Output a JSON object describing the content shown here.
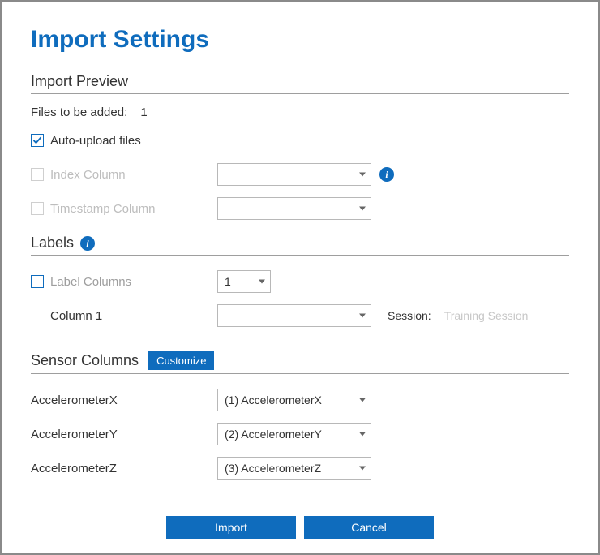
{
  "title": "Import Settings",
  "preview": {
    "heading": "Import Preview",
    "files_label": "Files to be added:",
    "files_count": "1",
    "auto_upload": {
      "label": "Auto-upload files",
      "checked": true
    },
    "index_col": {
      "label": "Index Column",
      "checked": false,
      "value": ""
    },
    "timestamp_col": {
      "label": "Timestamp Column",
      "checked": false,
      "value": ""
    }
  },
  "labels": {
    "heading": "Labels",
    "label_columns": {
      "label": "Label Columns",
      "checked": false,
      "count": "1"
    },
    "column1": {
      "label": "Column 1",
      "value": ""
    },
    "session_label": "Session:",
    "session_value": "Training Session"
  },
  "sensor": {
    "heading": "Sensor Columns",
    "customize_label": "Customize",
    "rows": [
      {
        "name": "AccelerometerX",
        "value": "(1) AccelerometerX"
      },
      {
        "name": "AccelerometerY",
        "value": "(2) AccelerometerY"
      },
      {
        "name": "AccelerometerZ",
        "value": "(3) AccelerometerZ"
      }
    ]
  },
  "buttons": {
    "import": "Import",
    "cancel": "Cancel"
  },
  "icons": {
    "info": "i"
  }
}
